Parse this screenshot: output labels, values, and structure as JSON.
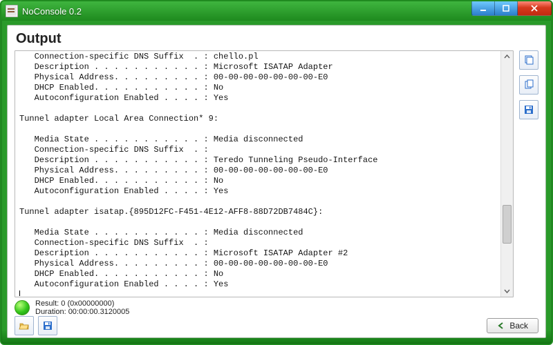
{
  "window": {
    "title": "NoConsole 0.2"
  },
  "heading": "Output",
  "output_text": "   Connection-specific DNS Suffix  . : chello.pl\n   Description . . . . . . . . . . . : Microsoft ISATAP Adapter\n   Physical Address. . . . . . . . . : 00-00-00-00-00-00-00-E0\n   DHCP Enabled. . . . . . . . . . . : No\n   Autoconfiguration Enabled . . . . : Yes\n\nTunnel adapter Local Area Connection* 9:\n\n   Media State . . . . . . . . . . . : Media disconnected\n   Connection-specific DNS Suffix  . :\n   Description . . . . . . . . . . . : Teredo Tunneling Pseudo-Interface\n   Physical Address. . . . . . . . . : 00-00-00-00-00-00-00-E0\n   DHCP Enabled. . . . . . . . . . . : No\n   Autoconfiguration Enabled . . . . : Yes\n\nTunnel adapter isatap.{895D12FC-F451-4E12-AFF8-88D72DB7484C}:\n\n   Media State . . . . . . . . . . . : Media disconnected\n   Connection-specific DNS Suffix  . :\n   Description . . . . . . . . . . . : Microsoft ISATAP Adapter #2\n   Physical Address. . . . . . . . . : 00-00-00-00-00-00-00-E0\n   DHCP Enabled. . . . . . . . . . . : No\n   Autoconfiguration Enabled . . . . : Yes\n",
  "status": {
    "result": "Result: 0 (0x00000000)",
    "duration": "Duration: 00:00:00.3120005"
  },
  "buttons": {
    "back": "Back"
  },
  "colors": {
    "accent_green": "#2a9a2a",
    "close_red": "#d63a1e",
    "win_blue": "#2b7ecb"
  }
}
